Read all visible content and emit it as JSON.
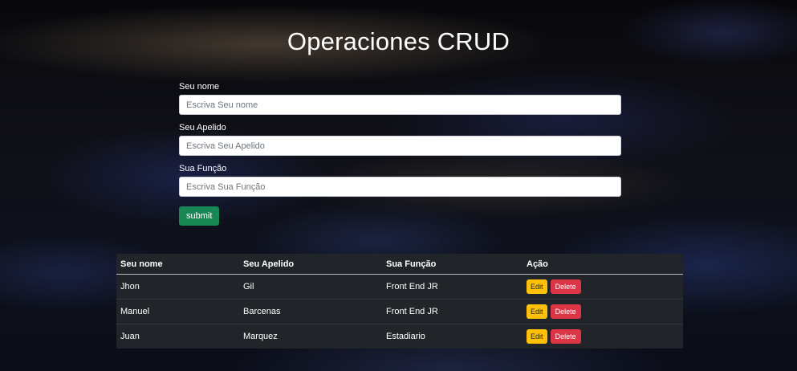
{
  "page": {
    "title": "Operaciones CRUD"
  },
  "form": {
    "fields": [
      {
        "label": "Seu nome",
        "placeholder": "Escriva Seu nome",
        "value": ""
      },
      {
        "label": "Seu Apelido",
        "placeholder": "Escriva Seu Apelido",
        "value": ""
      },
      {
        "label": "Sua Função",
        "placeholder": "Escriva Sua Função",
        "value": ""
      }
    ],
    "submit_label": "submit",
    "submit_color": "#198754"
  },
  "table": {
    "headers": [
      "Seu nome",
      "Seu Apelido",
      "Sua Função",
      "Ação"
    ],
    "rows": [
      {
        "nome": "Jhon",
        "apelido": "Gil",
        "funcao": "Front End JR",
        "edit_label": "Edit",
        "delete_label": "Delete"
      },
      {
        "nome": "Manuel",
        "apelido": "Barcenas",
        "funcao": "Front End JR",
        "edit_label": "Edit",
        "delete_label": "Delete"
      },
      {
        "nome": "Juan",
        "apelido": "Marquez",
        "funcao": "Estadiario",
        "edit_label": "Edit",
        "delete_label": "Delete"
      }
    ],
    "edit_color": "#ffc107",
    "delete_color": "#dc3545"
  }
}
